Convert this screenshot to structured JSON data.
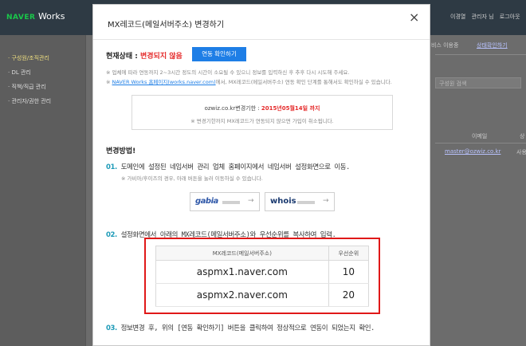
{
  "app": {
    "brand_naver": "NAVER",
    "brand_works": "Works",
    "top_right": [
      "이경열",
      "관리자 님",
      "로그아웃"
    ],
    "sidebar": [
      {
        "label": "· 구성원/조직관리",
        "active": true
      },
      {
        "label": "· DL 관리",
        "active": false
      },
      {
        "label": "· 직책/직급 관리",
        "active": false
      },
      {
        "label": "· 관리자/권한 관리",
        "active": false
      }
    ],
    "bg_service_text": "비스 이용중",
    "bg_service_link": "상태확인하기",
    "bg_search_placeholder": "구성원 검색",
    "bg_col_email": "이메일",
    "bg_col_status": "상",
    "bg_email": "master@ozwiz.co.kr",
    "bg_status": "사용"
  },
  "modal": {
    "title": "MX레코드(메일서버주소) 변경하기",
    "status_label": "현재상태 : ",
    "status_value": "변경되지 않음",
    "confirm_button": "연동 확인하기",
    "note1": "※ 업체에 따라 연동까지 2~3시간 정도의 시간이 소요될 수 있으니 정보를 입력하신 후 추후 다시 시도해 주세요.",
    "note2_prefix": "※ ",
    "note2_link": "NAVER Works 홈페이지(works.naver.com)",
    "note2_suffix": "에서, MX레코드(메일서버주소) 연동 확인 단계를 통해서도 확인하실 수 있습니다.",
    "info_domain": "ozwiz.co.kr변경기한 : ",
    "info_date": "2015년05월14일 까지",
    "info_note": "※ 변경기한까지 MX레코드가 연동되지 않으면 가입이 취소됩니다.",
    "method_heading": "변경방법!",
    "step1_num": "01.",
    "step1_text": " 도메인에 설정된 네임서버 관리 업체 홈페이지에서 네임서버 설정화면으로 이동.",
    "step1_sub": "※ 가비아/후이즈의 경우, 아래 버튼을 눌러 이동하실 수 있습니다.",
    "vendor1_name": "gabia",
    "vendor2_name": "whois",
    "vendor_arrow": "→",
    "step2_num": "02.",
    "step2_text": " 설정화면에서 아래의 MX레코드(메일서버주소)와 우선순위를 복사하여 입력.",
    "table_headers": [
      "MX레코드(메일서버주소)",
      "우선순위"
    ],
    "table_rows": [
      {
        "mx": "aspmx1.naver.com",
        "priority": "10"
      },
      {
        "mx": "aspmx2.naver.com",
        "priority": "20"
      }
    ],
    "step3_num": "03.",
    "step3_text": " 정보변경 후, 위의 [연동 확인하기] 버튼을 클릭하여 정상적으로 연동이 되었는지 확인.",
    "close_icon": "×",
    "colors": {
      "accent": "#1e7ee6",
      "alert": "#e52a2a",
      "step": "#1e9bb8",
      "highlight_box": "#e01818"
    }
  }
}
